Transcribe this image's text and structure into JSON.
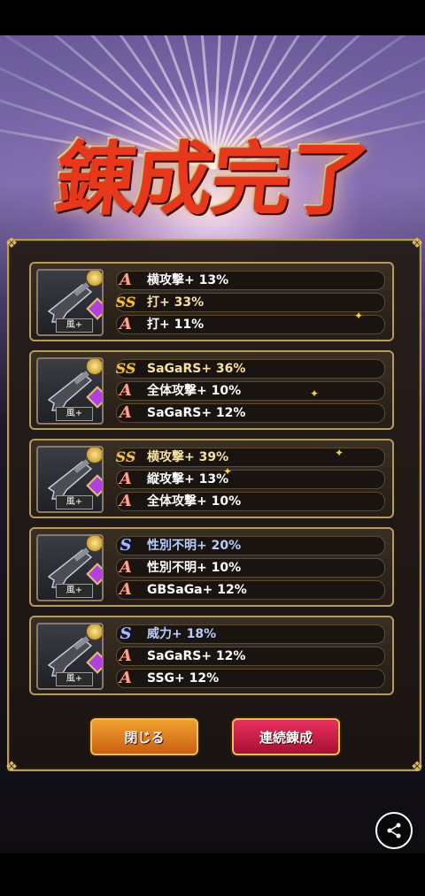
{
  "title": "錬成完了",
  "cards": [
    {
      "element": "風+",
      "rows": [
        {
          "rank": "A",
          "text": "横攻撃+ 13%"
        },
        {
          "rank": "SS",
          "text": "打+ 33%"
        },
        {
          "rank": "A",
          "text": "打+ 11%"
        }
      ]
    },
    {
      "element": "風+",
      "rows": [
        {
          "rank": "SS",
          "text": "SaGaRS+ 36%"
        },
        {
          "rank": "A",
          "text": "全体攻撃+ 10%"
        },
        {
          "rank": "A",
          "text": "SaGaRS+ 12%"
        }
      ]
    },
    {
      "element": "風+",
      "rows": [
        {
          "rank": "SS",
          "text": "横攻撃+ 39%"
        },
        {
          "rank": "A",
          "text": "縦攻撃+ 13%"
        },
        {
          "rank": "A",
          "text": "全体攻撃+ 10%"
        }
      ]
    },
    {
      "element": "風+",
      "rows": [
        {
          "rank": "S",
          "text": "性別不明+ 20%"
        },
        {
          "rank": "A",
          "text": "性別不明+ 10%"
        },
        {
          "rank": "A",
          "text": "GBSaGa+ 12%"
        }
      ]
    },
    {
      "element": "風+",
      "rows": [
        {
          "rank": "S",
          "text": "威力+ 18%"
        },
        {
          "rank": "A",
          "text": "SaGaRS+ 12%"
        },
        {
          "rank": "A",
          "text": "SSG+ 12%"
        }
      ]
    }
  ],
  "buttons": {
    "close": "閉じる",
    "repeat": "連続錬成"
  },
  "icons": {
    "weapon": "gun-icon",
    "share": "share-icon"
  },
  "colors": {
    "rank_a": "#f0a890",
    "rank_ss": "#f0c040",
    "rank_s": "#a8b8f8",
    "close_button": "#e08020",
    "repeat_button": "#c82048"
  }
}
